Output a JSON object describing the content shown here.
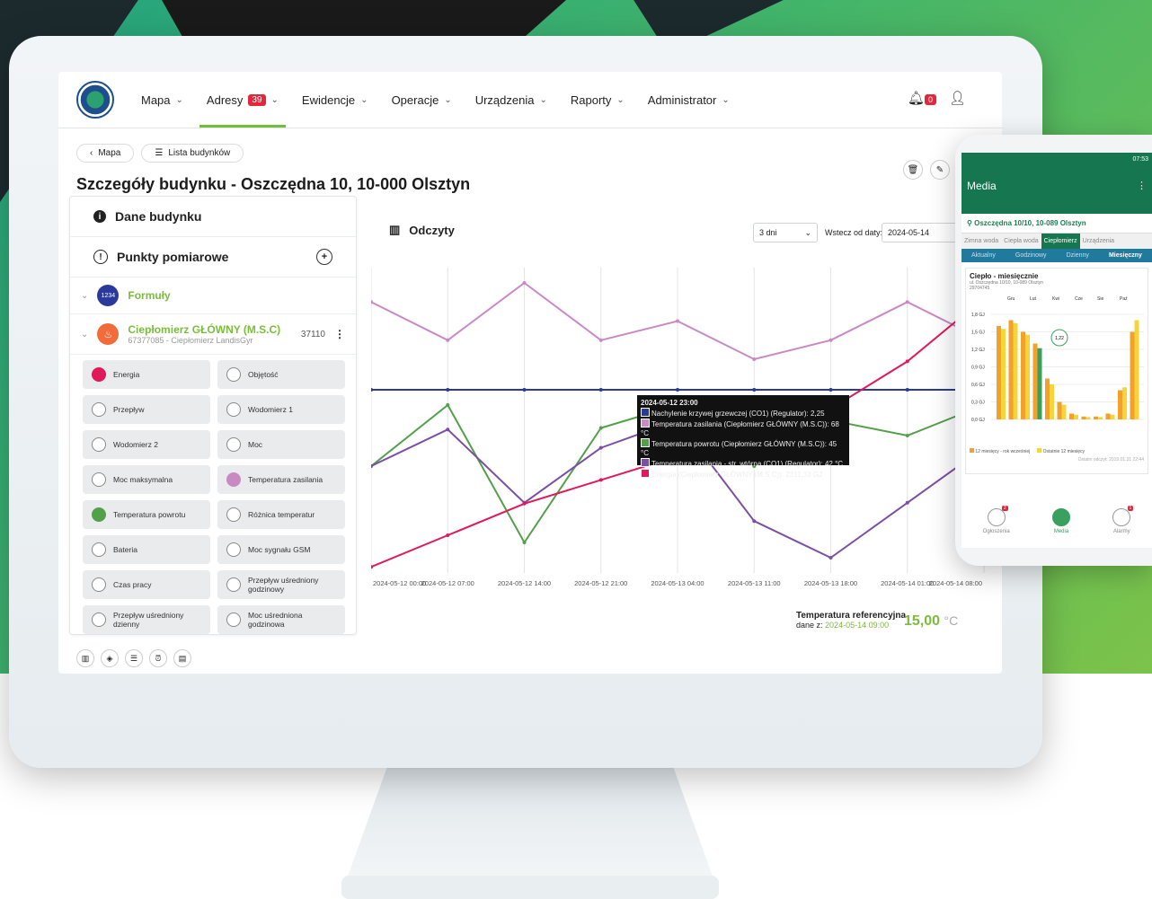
{
  "nav": {
    "items": [
      {
        "label": "Mapa"
      },
      {
        "label": "Adresy",
        "badge": "39"
      },
      {
        "label": "Ewidencje"
      },
      {
        "label": "Operacje"
      },
      {
        "label": "Urządzenia"
      },
      {
        "label": "Raporty"
      },
      {
        "label": "Administrator"
      }
    ],
    "notif_badge": "0"
  },
  "breadcrumb": {
    "back": "Mapa",
    "list": "Lista budynków"
  },
  "page_title": "Szczegóły budynku - Oszczędna 10, 10-000 Olsztyn",
  "left": {
    "section_data": "Dane budynku",
    "section_points": "Punkty pomiarowe",
    "formuly": {
      "label": "Formuły",
      "code": "1234"
    },
    "meter": {
      "name": "Ciepłomierz GŁÓWNY (M.S.C)",
      "sub": "67377085 - Ciepłomierz LandisGyr",
      "number": "37110"
    },
    "params": [
      {
        "label": "Energia",
        "color": "#e0195a"
      },
      {
        "label": "Objętość",
        "color": ""
      },
      {
        "label": "Przepływ",
        "color": ""
      },
      {
        "label": "Wodomierz 1",
        "color": ""
      },
      {
        "label": "Wodomierz 2",
        "color": ""
      },
      {
        "label": "Moc",
        "color": ""
      },
      {
        "label": "Moc maksymalna",
        "color": ""
      },
      {
        "label": "Temperatura zasilania",
        "color": "#c98ac4"
      },
      {
        "label": "Temperatura powrotu",
        "color": "#52a04a"
      },
      {
        "label": "Różnica temperatur",
        "color": ""
      },
      {
        "label": "Bateria",
        "color": ""
      },
      {
        "label": "Moc sygnału GSM",
        "color": ""
      },
      {
        "label": "Czas pracy",
        "color": ""
      },
      {
        "label": "Przepływ uśredniony godzinowy",
        "color": ""
      },
      {
        "label": "Przepływ uśredniony dzienny",
        "color": ""
      },
      {
        "label": "Moc uśredniona godzinowa",
        "color": ""
      }
    ]
  },
  "chart_panel": {
    "title": "Odczyty",
    "range": "3 dni",
    "since_label": "Wstecz od daty:",
    "since_value": "2024-05-14",
    "reference_label": "Temperatura referencyjna",
    "reference_date_prefix": "dane z:",
    "reference_date": "2024-05-14 09:00",
    "reference_value": "15,00",
    "reference_unit": "°C",
    "tooltip": {
      "title": "2024-05-12 23:00",
      "lines": [
        {
          "text": "Nachylenie krzywej grzewczej (CO1) (Regulator): 2,25",
          "color": "#2a3a9a"
        },
        {
          "text": "Temperatura zasilania (Ciepłomierz GŁÓWNY (M.S.C)): 68 °C",
          "color": "#c98ac4"
        },
        {
          "text": "Temperatura powrotu (Ciepłomierz GŁÓWNY (M.S.C)): 45 °C",
          "color": "#52a04a"
        },
        {
          "text": "Temperatura zasilania - str. wtórna (CO1) (Regulator): 42 °C",
          "color": "#7b4fa5"
        },
        {
          "text": "Energia (Ciepłomierz GŁÓWNY (M.S.C)): 2311,33 GJ",
          "color": "#e0195a"
        }
      ]
    }
  },
  "chart_data": {
    "type": "line",
    "x": [
      "2024-05-12 00:00",
      "2024-05-12 07:00",
      "2024-05-12 14:00",
      "2024-05-12 21:00",
      "2024-05-13 04:00",
      "2024-05-13 11:00",
      "2024-05-13 18:00",
      "2024-05-14 01:00",
      "2024-05-14 08:00"
    ],
    "series": [
      {
        "name": "Nachylenie krzywej grzewczej (CO1) (Regulator)",
        "color": "#2a3a9a",
        "values": [
          2.25,
          2.25,
          2.25,
          2.25,
          2.25,
          2.25,
          2.25,
          2.25,
          2.25
        ]
      },
      {
        "name": "Temperatura zasilania (Ciepłomierz GŁÓWNY (M.S.C))",
        "color": "#c98ac4",
        "values": [
          72,
          68,
          74,
          68,
          70,
          66,
          68,
          72,
          68
        ]
      },
      {
        "name": "Temperatura powrotu (Ciepłomierz GŁÓWNY (M.S.C))",
        "color": "#52a04a",
        "values": [
          40,
          48,
          30,
          45,
          48,
          40,
          46,
          44,
          48
        ]
      },
      {
        "name": "Temperatura zasilania - str. wtórna (CO1) (Regulator)",
        "color": "#7b4fa5",
        "values": [
          40,
          44,
          36,
          42,
          45,
          34,
          30,
          36,
          42
        ]
      },
      {
        "name": "Energia (Ciepłomierz GŁÓWNY (M.S.C))",
        "color": "#e0195a",
        "values": [
          2300,
          2304,
          2308,
          2311,
          2314,
          2317,
          2320,
          2326,
          2334
        ]
      }
    ]
  },
  "phone": {
    "status": "07:53",
    "title": "Media",
    "address": "Oszczędna 10/10, 10-089 Olsztyn",
    "tabs": [
      "Zimna woda",
      "Ciepła woda",
      "Ciepłomierz",
      "Urządzenia"
    ],
    "active_tab": "Ciepłomierz",
    "subtabs": [
      "Aktualny",
      "Godzinowy",
      "Dzienny",
      "Miesięczny"
    ],
    "card_title": "Ciepło - miesięcznie",
    "card_sub": "ul. Oszczędna 10/10, 10-089 Olsztyn",
    "card_id": "29704745",
    "months": [
      "Gru",
      "Lut",
      "Kwi",
      "Cze",
      "Sie",
      "Paź"
    ],
    "yticks": [
      "1,8 GJ",
      "1,5 GJ",
      "1,2 GJ",
      "0,9 GJ",
      "0,6 GJ",
      "0,3 GJ",
      "0,0 GJ"
    ],
    "marker": "1,22",
    "legend_a": "12 miesięcy - rok wcześniej",
    "legend_b": "Ostatnie 12 miesięcy",
    "last_reading": "Ostatni odczyt: 2019.01.31 22:44",
    "bottom": [
      {
        "label": "Ogłoszenia",
        "badge": "2"
      },
      {
        "label": "Media",
        "badge": ""
      },
      {
        "label": "Alarmy",
        "badge": "1"
      }
    ]
  }
}
